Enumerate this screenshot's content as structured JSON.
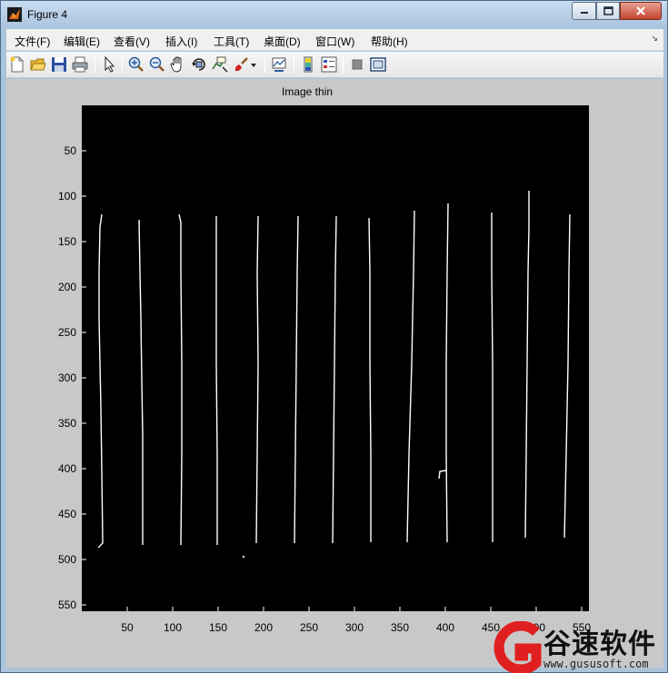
{
  "window": {
    "title": "Figure 4"
  },
  "menu": {
    "items": [
      "文件(F)",
      "编辑(E)",
      "查看(V)",
      "插入(I)",
      "工具(T)",
      "桌面(D)",
      "窗口(W)",
      "帮助(H)"
    ]
  },
  "toolbar": {
    "icons": [
      "new-figure-icon",
      "open-file-icon",
      "save-icon",
      "print-icon",
      "edit-plot-arrow-icon",
      "zoom-in-icon",
      "zoom-out-icon",
      "pan-hand-icon",
      "rotate-3d-icon",
      "data-cursor-icon",
      "brush-icon",
      "brush-dropdown-icon",
      "link-plot-icon",
      "colorbar-icon",
      "legend-icon",
      "hide-plot-tools-icon",
      "show-plot-tools-icon"
    ]
  },
  "plot": {
    "title": "Image thin",
    "yticks": [
      "50",
      "100",
      "150",
      "200",
      "250",
      "300",
      "350",
      "400",
      "450",
      "500",
      "550"
    ],
    "xticks": [
      "50",
      "100",
      "150",
      "200",
      "250",
      "300",
      "350",
      "400",
      "450",
      "500",
      "550"
    ],
    "background": "#000000",
    "line_color": "#ffffff",
    "figure_color": "#c8c8c8"
  },
  "watermark": {
    "brand": "谷速软件",
    "url": "www.gususoft.com",
    "logo": "G",
    "logo_color": "#e02020"
  }
}
